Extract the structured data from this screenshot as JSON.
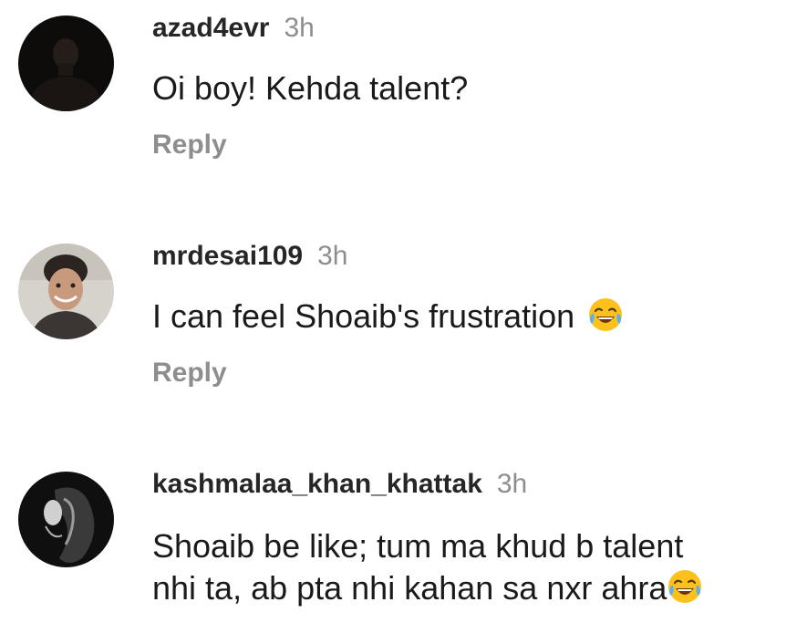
{
  "comments": [
    {
      "username": "azad4evr",
      "time": "3h",
      "text": "Oi boy! Kehda talent?",
      "reply_label": "Reply",
      "avatar_icon": "dark-profile-photo"
    },
    {
      "username": "mrdesai109",
      "time": "3h",
      "text": "I can feel Shoaib's frustration",
      "emoji": "tears-of-joy-emoji",
      "reply_label": "Reply",
      "avatar_icon": "smiling-man-profile-photo"
    },
    {
      "username": "kashmalaa_khan_khattak",
      "time": "3h",
      "text_line1": "Shoaib be like; tum ma khud b talent",
      "text_line2": "nhi ta, ab pta nhi kahan sa nxr ahra",
      "emoji": "tears-of-joy-emoji",
      "avatar_icon": "black-white-profile-photo"
    }
  ],
  "colors": {
    "username": "#262626",
    "meta": "#8e8e8e",
    "text": "#1a1a1a",
    "emoji_face": "#fcc21b"
  }
}
